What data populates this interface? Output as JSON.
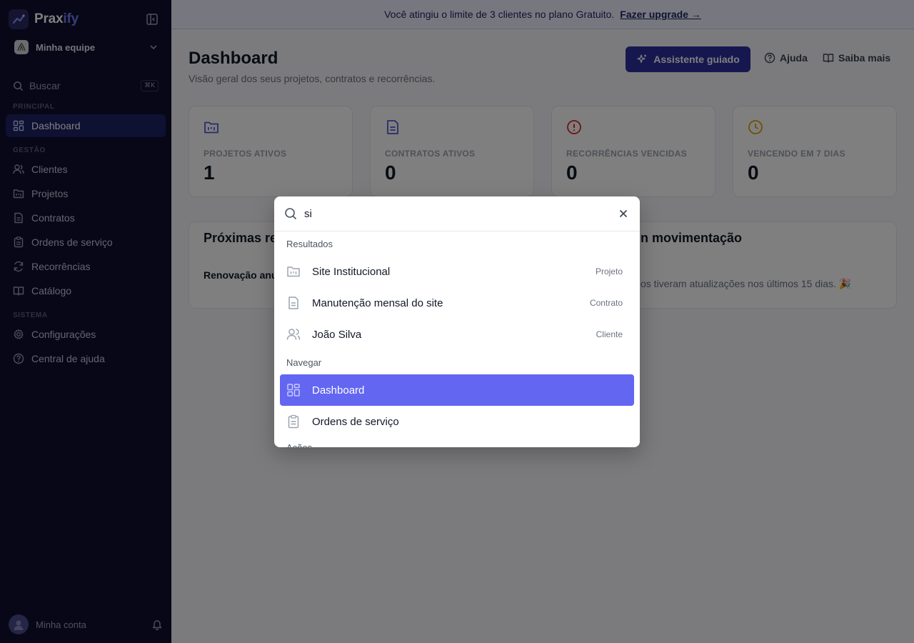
{
  "brand": {
    "name_main": "Prax",
    "name_accent": "ify"
  },
  "sidebar": {
    "team": "Minha equipe",
    "search_placeholder": "Buscar",
    "search_shortcut": "⌘K",
    "sections": {
      "principal": "PRINCIPAL",
      "gestao": "GESTÃO",
      "sistema": "SISTEMA"
    },
    "items": {
      "dashboard": "Dashboard",
      "clientes": "Clientes",
      "projetos": "Projetos",
      "contratos": "Contratos",
      "ordens": "Ordens de serviço",
      "recorrencias": "Recorrências",
      "catalogo": "Catálogo",
      "configuracoes": "Configurações",
      "central": "Central de ajuda"
    },
    "account": "Minha conta"
  },
  "banner": {
    "text": "Você atingiu o limite de 3 clientes no plano Gratuito.",
    "link": "Fazer upgrade →"
  },
  "header": {
    "title": "Dashboard",
    "subtitle": "Visão geral dos seus projetos, contratos e recorrências.",
    "guided_button": "Assistente guiado",
    "help": "Ajuda",
    "learn_more": "Saiba mais"
  },
  "stats": [
    {
      "label": "PROJETOS ATIVOS",
      "value": "1",
      "color": "#4f5bd5",
      "icon": "folder-kanban-icon"
    },
    {
      "label": "CONTRATOS ATIVOS",
      "value": "0",
      "color": "#4f5bd5",
      "icon": "file-text-icon"
    },
    {
      "label": "RECORRÊNCIAS VENCIDAS",
      "value": "0",
      "color": "#dc2626",
      "icon": "alert-circle-icon"
    },
    {
      "label": "VENCENDO EM 7 DIAS",
      "value": "0",
      "color": "#d9a406",
      "icon": "clock-icon"
    }
  ],
  "panels": {
    "left_title_partial": "Próximas re",
    "left_row_partial": "Renovação anu",
    "right_title_partial": "n movimentação",
    "right_empty_partial": "os tiveram atualizações nos últimos 15 dias. 🎉"
  },
  "palette": {
    "query": "si",
    "results_label": "Resultados",
    "results": [
      {
        "label": "Site Institucional",
        "kind": "Projeto",
        "icon": "folder-kanban-icon"
      },
      {
        "label": "Manutenção mensal do site",
        "kind": "Contrato",
        "icon": "file-text-icon"
      },
      {
        "label": "João Silva",
        "kind": "Cliente",
        "icon": "users-icon"
      }
    ],
    "navigate_label": "Navegar",
    "navigate": [
      {
        "label": "Dashboard",
        "icon": "layout-dashboard-icon",
        "selected": true
      },
      {
        "label": "Ordens de serviço",
        "icon": "clipboard-list-icon",
        "selected": false
      }
    ],
    "cut_label": "Ações"
  },
  "colors": {
    "sidebar_bg": "#0f0e2e",
    "accent": "#6366f1",
    "primary_button": "#2f2ea0"
  }
}
